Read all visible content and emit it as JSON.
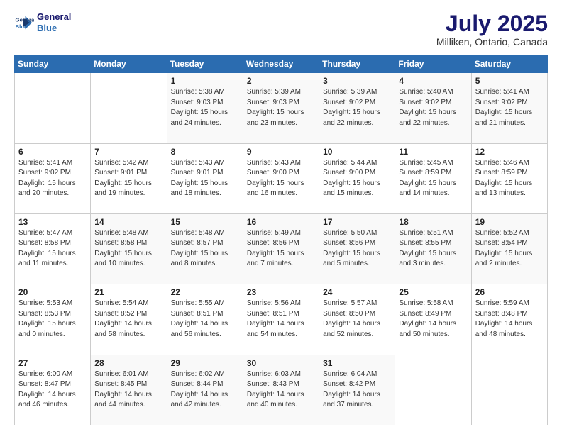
{
  "logo": {
    "line1": "General",
    "line2": "Blue"
  },
  "title": "July 2025",
  "subtitle": "Milliken, Ontario, Canada",
  "days_header": [
    "Sunday",
    "Monday",
    "Tuesday",
    "Wednesday",
    "Thursday",
    "Friday",
    "Saturday"
  ],
  "weeks": [
    [
      {
        "day": "",
        "info": ""
      },
      {
        "day": "",
        "info": ""
      },
      {
        "day": "1",
        "info": "Sunrise: 5:38 AM\nSunset: 9:03 PM\nDaylight: 15 hours\nand 24 minutes."
      },
      {
        "day": "2",
        "info": "Sunrise: 5:39 AM\nSunset: 9:03 PM\nDaylight: 15 hours\nand 23 minutes."
      },
      {
        "day": "3",
        "info": "Sunrise: 5:39 AM\nSunset: 9:02 PM\nDaylight: 15 hours\nand 22 minutes."
      },
      {
        "day": "4",
        "info": "Sunrise: 5:40 AM\nSunset: 9:02 PM\nDaylight: 15 hours\nand 22 minutes."
      },
      {
        "day": "5",
        "info": "Sunrise: 5:41 AM\nSunset: 9:02 PM\nDaylight: 15 hours\nand 21 minutes."
      }
    ],
    [
      {
        "day": "6",
        "info": "Sunrise: 5:41 AM\nSunset: 9:02 PM\nDaylight: 15 hours\nand 20 minutes."
      },
      {
        "day": "7",
        "info": "Sunrise: 5:42 AM\nSunset: 9:01 PM\nDaylight: 15 hours\nand 19 minutes."
      },
      {
        "day": "8",
        "info": "Sunrise: 5:43 AM\nSunset: 9:01 PM\nDaylight: 15 hours\nand 18 minutes."
      },
      {
        "day": "9",
        "info": "Sunrise: 5:43 AM\nSunset: 9:00 PM\nDaylight: 15 hours\nand 16 minutes."
      },
      {
        "day": "10",
        "info": "Sunrise: 5:44 AM\nSunset: 9:00 PM\nDaylight: 15 hours\nand 15 minutes."
      },
      {
        "day": "11",
        "info": "Sunrise: 5:45 AM\nSunset: 8:59 PM\nDaylight: 15 hours\nand 14 minutes."
      },
      {
        "day": "12",
        "info": "Sunrise: 5:46 AM\nSunset: 8:59 PM\nDaylight: 15 hours\nand 13 minutes."
      }
    ],
    [
      {
        "day": "13",
        "info": "Sunrise: 5:47 AM\nSunset: 8:58 PM\nDaylight: 15 hours\nand 11 minutes."
      },
      {
        "day": "14",
        "info": "Sunrise: 5:48 AM\nSunset: 8:58 PM\nDaylight: 15 hours\nand 10 minutes."
      },
      {
        "day": "15",
        "info": "Sunrise: 5:48 AM\nSunset: 8:57 PM\nDaylight: 15 hours\nand 8 minutes."
      },
      {
        "day": "16",
        "info": "Sunrise: 5:49 AM\nSunset: 8:56 PM\nDaylight: 15 hours\nand 7 minutes."
      },
      {
        "day": "17",
        "info": "Sunrise: 5:50 AM\nSunset: 8:56 PM\nDaylight: 15 hours\nand 5 minutes."
      },
      {
        "day": "18",
        "info": "Sunrise: 5:51 AM\nSunset: 8:55 PM\nDaylight: 15 hours\nand 3 minutes."
      },
      {
        "day": "19",
        "info": "Sunrise: 5:52 AM\nSunset: 8:54 PM\nDaylight: 15 hours\nand 2 minutes."
      }
    ],
    [
      {
        "day": "20",
        "info": "Sunrise: 5:53 AM\nSunset: 8:53 PM\nDaylight: 15 hours\nand 0 minutes."
      },
      {
        "day": "21",
        "info": "Sunrise: 5:54 AM\nSunset: 8:52 PM\nDaylight: 14 hours\nand 58 minutes."
      },
      {
        "day": "22",
        "info": "Sunrise: 5:55 AM\nSunset: 8:51 PM\nDaylight: 14 hours\nand 56 minutes."
      },
      {
        "day": "23",
        "info": "Sunrise: 5:56 AM\nSunset: 8:51 PM\nDaylight: 14 hours\nand 54 minutes."
      },
      {
        "day": "24",
        "info": "Sunrise: 5:57 AM\nSunset: 8:50 PM\nDaylight: 14 hours\nand 52 minutes."
      },
      {
        "day": "25",
        "info": "Sunrise: 5:58 AM\nSunset: 8:49 PM\nDaylight: 14 hours\nand 50 minutes."
      },
      {
        "day": "26",
        "info": "Sunrise: 5:59 AM\nSunset: 8:48 PM\nDaylight: 14 hours\nand 48 minutes."
      }
    ],
    [
      {
        "day": "27",
        "info": "Sunrise: 6:00 AM\nSunset: 8:47 PM\nDaylight: 14 hours\nand 46 minutes."
      },
      {
        "day": "28",
        "info": "Sunrise: 6:01 AM\nSunset: 8:45 PM\nDaylight: 14 hours\nand 44 minutes."
      },
      {
        "day": "29",
        "info": "Sunrise: 6:02 AM\nSunset: 8:44 PM\nDaylight: 14 hours\nand 42 minutes."
      },
      {
        "day": "30",
        "info": "Sunrise: 6:03 AM\nSunset: 8:43 PM\nDaylight: 14 hours\nand 40 minutes."
      },
      {
        "day": "31",
        "info": "Sunrise: 6:04 AM\nSunset: 8:42 PM\nDaylight: 14 hours\nand 37 minutes."
      },
      {
        "day": "",
        "info": ""
      },
      {
        "day": "",
        "info": ""
      }
    ]
  ]
}
